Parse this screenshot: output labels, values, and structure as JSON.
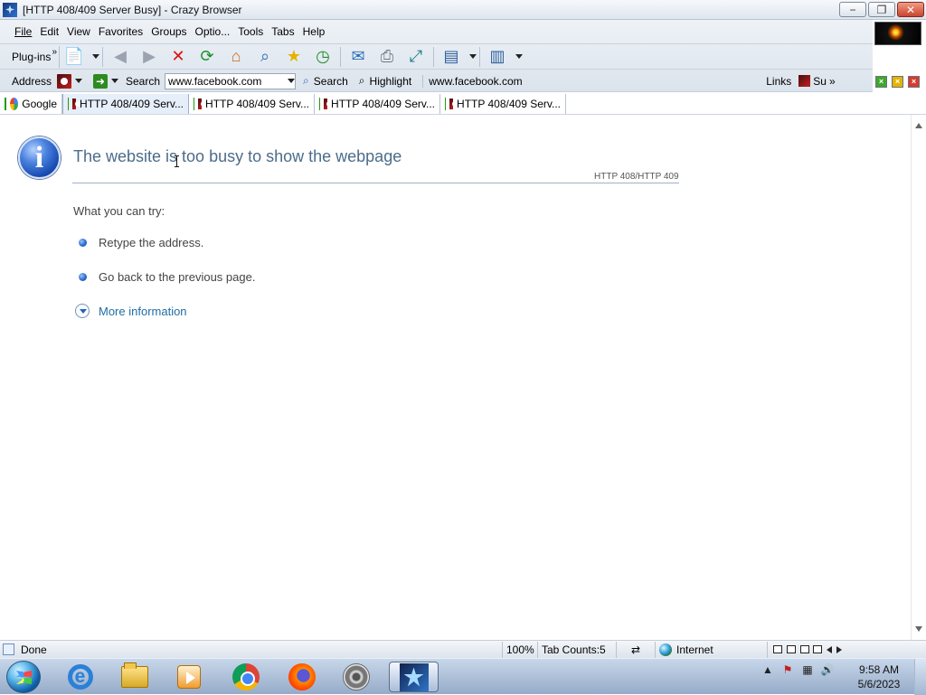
{
  "window": {
    "title": "[HTTP 408/409 Server Busy] - Crazy Browser",
    "minimize": "−",
    "restore": "❐",
    "close": "✕"
  },
  "menu": {
    "items": [
      "File",
      "Edit",
      "View",
      "Favorites",
      "Groups",
      "Optio...",
      "Tools",
      "Tabs",
      "Help"
    ]
  },
  "toolbar": {
    "plugins_label": "Plug-ins",
    "plugins_chevron": "»",
    "icons": [
      "new-page-icon",
      "back-icon",
      "forward-icon",
      "stop-icon",
      "refresh-icon",
      "home-icon",
      "search-icon",
      "favorites-icon",
      "history-icon",
      "mail-icon",
      "print-icon",
      "fullscreen-icon",
      "view-icon",
      "options-icon"
    ]
  },
  "address_bar": {
    "address_label": "Address",
    "search_label": "Search",
    "search_value": "www.facebook.com",
    "search_button": "Search",
    "highlight_button": "Highlight",
    "current_address": "www.facebook.com",
    "links_label": "Links",
    "short_link": "Su",
    "links_chevron": "»"
  },
  "tabs": [
    {
      "label": "Google",
      "icon": "google-icon"
    },
    {
      "label": "HTTP 408/409 Serv...",
      "icon": "page-icon",
      "active": true
    },
    {
      "label": "HTTP 408/409 Serv...",
      "icon": "page-icon"
    },
    {
      "label": "HTTP 408/409 Serv...",
      "icon": "page-icon"
    },
    {
      "label": "HTTP 408/409 Serv...",
      "icon": "page-icon"
    }
  ],
  "page": {
    "icon_letter": "i",
    "title": "The website is too busy to show the webpage",
    "code": "HTTP 408/HTTP 409",
    "try_label": "What you can try:",
    "bullets": [
      "Retype the address.",
      "Go back to the previous page."
    ],
    "more_information": "More information"
  },
  "statusbar": {
    "done": "Done",
    "zoom": "100%",
    "tab_count": "Tab Counts:5",
    "zone": "Internet"
  },
  "taskbar": {
    "ie_letter": "e",
    "time": "9:58 AM",
    "date": "5/6/2023"
  },
  "colors": {
    "title_blue": "#4b6c8a",
    "link_blue": "#1f6da4",
    "active_tab": "#e6eefa"
  }
}
